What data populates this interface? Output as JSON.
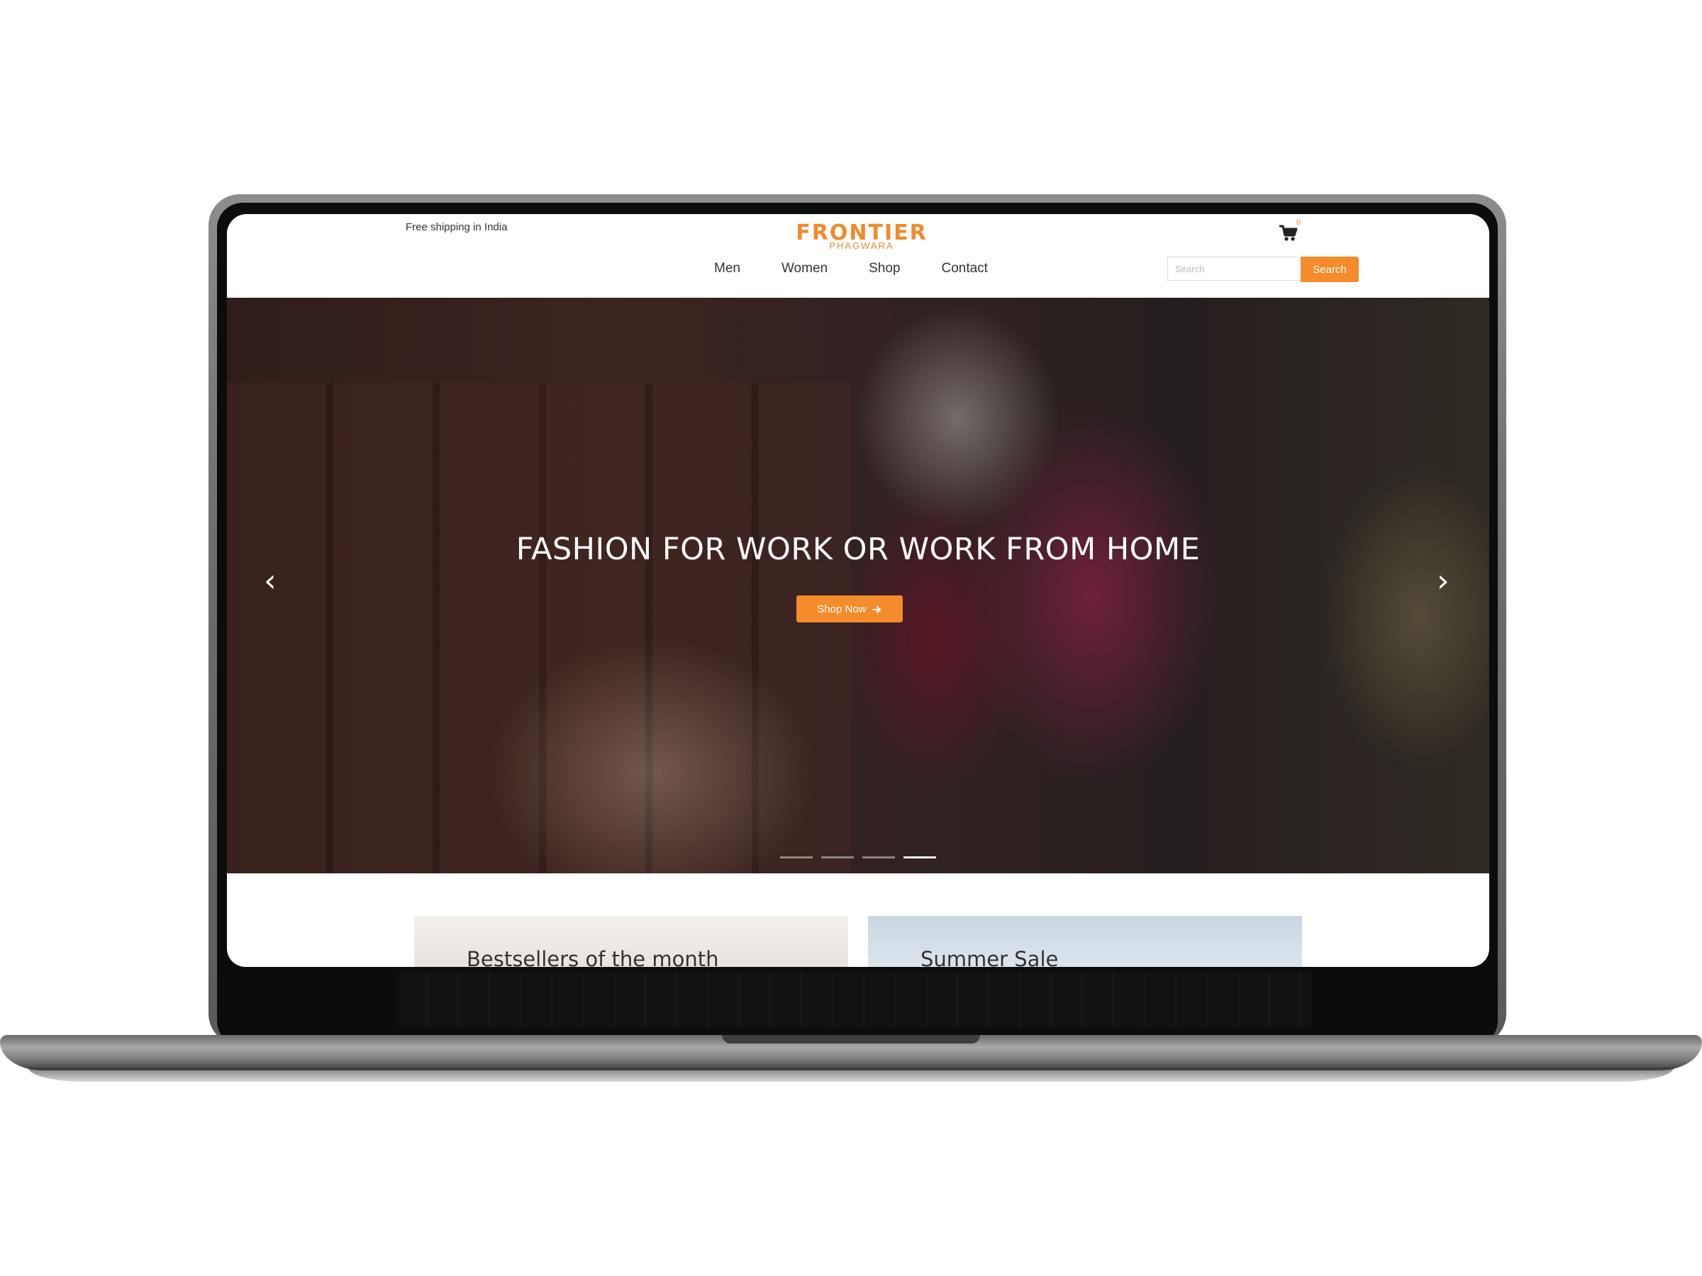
{
  "topbar": {
    "shipping_text": "Free shipping in India",
    "logo_main": "FRONTIER",
    "logo_sub": "PHAGWARA",
    "cart_count": "0"
  },
  "nav": {
    "items": [
      {
        "label": "Men"
      },
      {
        "label": "Women"
      },
      {
        "label": "Shop"
      },
      {
        "label": "Contact"
      }
    ]
  },
  "search": {
    "placeholder": "Search",
    "button_label": "Search"
  },
  "hero": {
    "title": "FASHION FOR WORK OR WORK FROM HOME",
    "cta_label": "Shop Now",
    "slide_count": 4,
    "active_slide": 4
  },
  "categories": [
    {
      "title": "Bestsellers of the month"
    },
    {
      "title": "Summer Sale"
    }
  ],
  "colors": {
    "accent": "#f58c2c",
    "text": "#333333"
  }
}
